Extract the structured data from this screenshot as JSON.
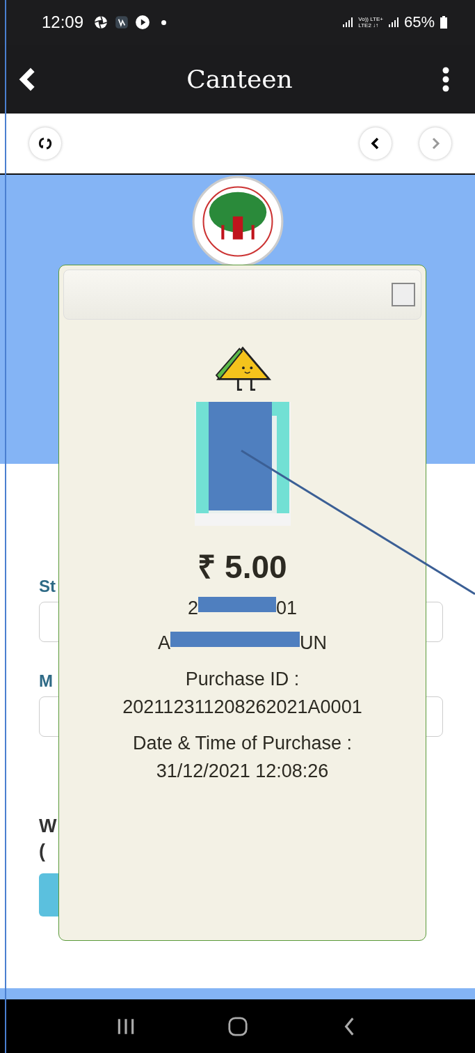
{
  "status_bar": {
    "time": "12:09",
    "network_top": "Vo)) LTE+",
    "network_bottom": "LTE2 ↓↑",
    "battery": "65%"
  },
  "app_bar": {
    "title": "Canteen"
  },
  "form_behind": {
    "labels": [
      "St",
      "M"
    ],
    "heading_lines": [
      "W",
      "("
    ]
  },
  "modal": {
    "amount": "₹ 5.00",
    "student_id_parts": [
      "2",
      "01"
    ],
    "student_name_parts": [
      "A",
      "UN"
    ],
    "purchase_id_label": "Purchase ID :",
    "purchase_id": "202112311208262021A0001",
    "datetime_label": "Date & Time of Purchase :",
    "datetime": "31/12/2021 12:08:26",
    "checked": false
  }
}
